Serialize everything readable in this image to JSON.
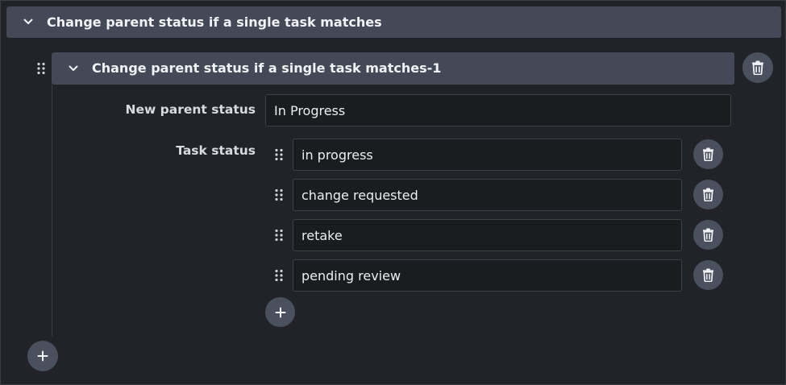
{
  "section": {
    "title": "Change parent status if a single task matches"
  },
  "rule": {
    "title": "Change parent status if a single task matches-1",
    "new_parent_status_label": "New parent status",
    "new_parent_status_value": "In Progress",
    "task_status_label": "Task status",
    "task_statuses": [
      "in progress",
      "change requested",
      "retake",
      "pending review"
    ]
  },
  "icons": {
    "collapse": "chevron-down-icon",
    "drag": "drag-handle-icon",
    "delete": "trash-icon",
    "add": "plus-icon"
  }
}
